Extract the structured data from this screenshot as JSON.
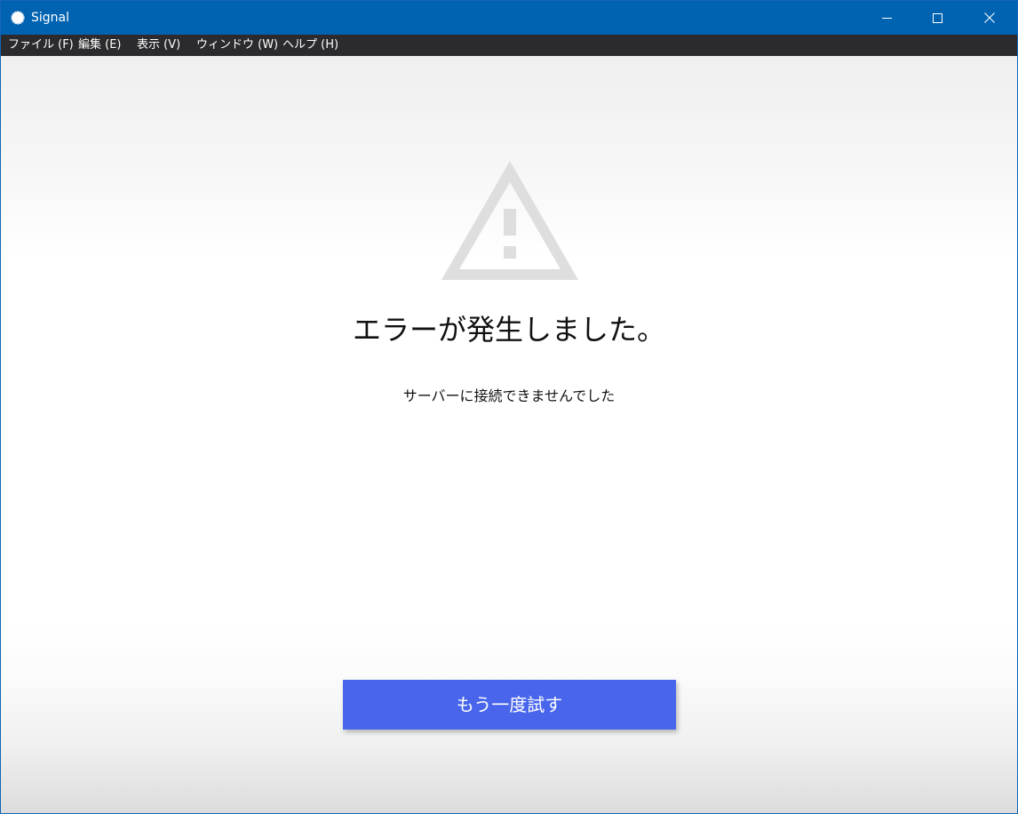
{
  "window": {
    "title": "Signal",
    "icon": "signal-logo-icon",
    "controls": [
      "minimize-icon",
      "maximize-icon",
      "close-icon"
    ]
  },
  "menu": {
    "items": [
      {
        "label": "ファイル (F)"
      },
      {
        "label": "編集 (E)"
      },
      {
        "label": "表示 (V)"
      },
      {
        "label": "ウィンドウ (W)"
      },
      {
        "label": "ヘルプ (H)"
      }
    ]
  },
  "error": {
    "icon": "warning-icon",
    "title": "エラーが発生しました。",
    "message": "サーバーに接続できませんでした"
  },
  "actions": {
    "retry_label": "もう一度試す"
  },
  "colors": {
    "titlebar": "#0063b1",
    "menubar": "#2b2b2e",
    "button": "#4865ec",
    "warning_icon": "#dedede"
  }
}
